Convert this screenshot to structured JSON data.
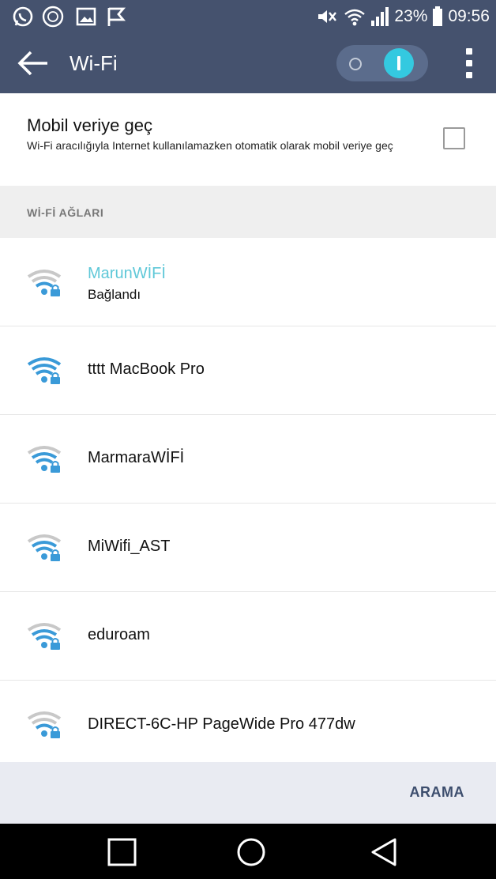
{
  "status_bar": {
    "icons_left": [
      "whatsapp-icon",
      "circle-icon",
      "gallery-icon",
      "flag-icon"
    ],
    "icons_right": [
      "mute-icon",
      "wifi-icon",
      "signal-icon",
      "battery-icon"
    ],
    "battery": "23%",
    "time": "09:56"
  },
  "app_bar": {
    "title": "Wi-Fi",
    "wifi_toggle_on": true
  },
  "mobile_data": {
    "title": "Mobil veriye geç",
    "description": "Wi-Fi aracılığıyla Internet kullanılamazken otomatik olarak mobil veriye geç",
    "checked": false
  },
  "networks_section": {
    "label": "Wİ-Fİ AĞLARI"
  },
  "networks": [
    {
      "name": "MarunWİFİ",
      "status": "Bağlandı",
      "signal": "weak",
      "locked": true,
      "connected": true
    },
    {
      "name": "tttt MacBook Pro",
      "status": "",
      "signal": "full",
      "locked": true,
      "connected": false
    },
    {
      "name": "MarmaraWİFİ",
      "status": "",
      "signal": "medium",
      "locked": true,
      "connected": false
    },
    {
      "name": "MiWifi_AST",
      "status": "",
      "signal": "medium",
      "locked": true,
      "connected": false
    },
    {
      "name": "eduroam",
      "status": "",
      "signal": "medium",
      "locked": true,
      "connected": false
    },
    {
      "name": "DIRECT-6C-HP PageWide Pro 477dw",
      "status": "",
      "signal": "weak",
      "locked": true,
      "connected": false
    }
  ],
  "footer": {
    "search_label": "ARAMA"
  },
  "nav": [
    "recents-square-icon",
    "home-circle-icon",
    "back-triangle-icon"
  ],
  "colors": {
    "header": "#45526e",
    "accent": "#34c9e0",
    "connected_name": "#5fc8d8",
    "wifi_active": "#3a9ad8",
    "wifi_inactive": "#c8c8c8",
    "footer_bg": "#e9ebf2",
    "footer_text": "#3c4d6d"
  }
}
